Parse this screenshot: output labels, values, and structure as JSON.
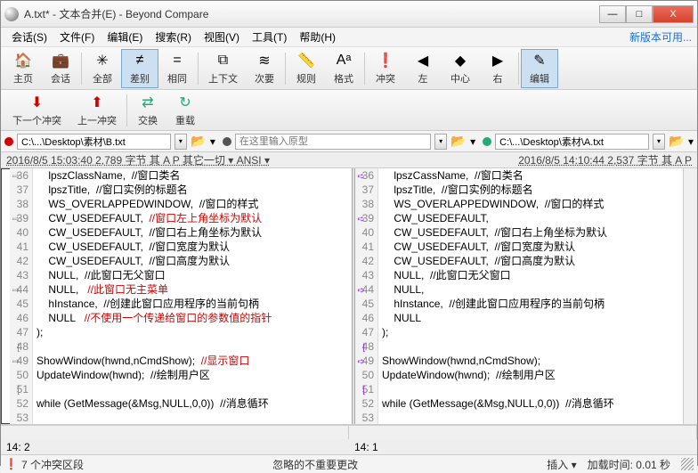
{
  "title": "A.txt* - 文本合并(E) - Beyond Compare",
  "window_buttons": {
    "min": "—",
    "max": "□",
    "close": "X"
  },
  "menu": [
    "会话(S)",
    "文件(F)",
    "编辑(E)",
    "搜索(R)",
    "视图(V)",
    "工具(T)",
    "帮助(H)"
  ],
  "menu_right": "新版本可用...",
  "toolbar1": [
    {
      "icon": "🏠",
      "label": "主页",
      "name": "home"
    },
    {
      "icon": "💼",
      "label": "会话",
      "name": "session"
    },
    {
      "sep": true
    },
    {
      "icon": "✳",
      "label": "全部",
      "name": "all"
    },
    {
      "icon": "≠",
      "label": "差别",
      "name": "diff",
      "pressed": true
    },
    {
      "icon": "=",
      "label": "相同",
      "name": "same"
    },
    {
      "sep": true
    },
    {
      "icon": "⧉",
      "label": "上下文",
      "name": "context"
    },
    {
      "icon": "≋",
      "label": "次要",
      "name": "minor"
    },
    {
      "sep": true
    },
    {
      "icon": "📏",
      "label": "规则",
      "name": "rules"
    },
    {
      "icon": "Aᵃ",
      "label": "格式",
      "name": "format"
    },
    {
      "sep": true
    },
    {
      "icon": "❗",
      "label": "冲突",
      "name": "conflict"
    },
    {
      "icon": "◀",
      "label": "左",
      "name": "left"
    },
    {
      "icon": "◆",
      "label": "中心",
      "name": "center"
    },
    {
      "icon": "▶",
      "label": "右",
      "name": "right"
    },
    {
      "sep": true
    },
    {
      "icon": "✎",
      "label": "编辑",
      "name": "edit",
      "pressed": true
    }
  ],
  "toolbar2": [
    {
      "icon": "⬇",
      "label": "下一个冲突",
      "name": "next-conflict",
      "color": "#d00000"
    },
    {
      "icon": "⬆",
      "label": "上一冲突",
      "name": "prev-conflict",
      "color": "#d00000"
    },
    {
      "sep": true
    },
    {
      "icon": "⇄",
      "label": "交换",
      "name": "swap",
      "color": "#2a7"
    },
    {
      "icon": "↻",
      "label": "重载",
      "name": "reload",
      "color": "#2a7"
    }
  ],
  "paths": {
    "left": {
      "dot": "#d00000",
      "value": "C:\\...\\Desktop\\素材\\B.txt"
    },
    "mid": {
      "dot": "#555",
      "placeholder": "在这里输入原型"
    },
    "right": {
      "dot": "#2a7",
      "value": "C:\\...\\Desktop\\素材\\A.txt"
    }
  },
  "info": {
    "left": "2016/8/5 15:03:40   2,789 字节   其   A   P   其它一切 ▾   ANSI ▾",
    "right": "2016/8/5 14:10:44   2,537 字节   其   A   P"
  },
  "left_lines": [
    {
      "n": 36,
      "a": "⇨",
      "t": "    lpszClassName,  //窗口类名"
    },
    {
      "n": 37,
      "t": "    lpszTitle,  //窗口实例的标题名"
    },
    {
      "n": 38,
      "t": "    WS_OVERLAPPEDWINDOW,  //窗口的样式"
    },
    {
      "n": 39,
      "a": "⇨",
      "t": "    CW_USEDEFAULT,  ",
      "r": "//窗口左上角坐标为默认"
    },
    {
      "n": 40,
      "t": "    CW_USEDEFAULT,  //窗口右上角坐标为默认"
    },
    {
      "n": 41,
      "t": "    CW_USEDEFAULT,  //窗口宽度为默认"
    },
    {
      "n": 42,
      "t": "    CW_USEDEFAULT,  //窗口高度为默认"
    },
    {
      "n": 43,
      "t": "    NULL,  //此窗口无父窗口"
    },
    {
      "n": 44,
      "a": "⇨",
      "t": "    NULL,   ",
      "r": "//此窗口无主菜单"
    },
    {
      "n": 45,
      "t": "    hInstance,  //创建此窗口应用程序的当前句柄"
    },
    {
      "n": 46,
      "t": "    NULL   ",
      "r": "//不使用一个传递给窗口的参数值的指针"
    },
    {
      "n": 47,
      "t": ");"
    },
    {
      "n": 48,
      "a": "[",
      "t": ""
    },
    {
      "n": 49,
      "a": "⇨",
      "t": "ShowWindow(hwnd,nCmdShow);  ",
      "r": "//显示窗口"
    },
    {
      "n": 50,
      "t": "UpdateWindow(hwnd);  //绘制用户区"
    },
    {
      "n": 51,
      "a": "[",
      "t": ""
    },
    {
      "n": 52,
      "t": "while (GetMessage(&Msg,NULL,0,0))  //消息循环"
    },
    {
      "n": 53,
      "t": ""
    }
  ],
  "right_lines": [
    {
      "n": 36,
      "a": "➪",
      "t": "    lpszCassName,  //窗口类名"
    },
    {
      "n": 37,
      "t": "    lpszTitle,  //窗口实例的标题名"
    },
    {
      "n": 38,
      "t": "    WS_OVERLAPPEDWINDOW,  //窗口的样式"
    },
    {
      "n": 39,
      "a": "➪",
      "t": "    CW_USEDEFAULT,"
    },
    {
      "n": 40,
      "t": "    CW_USEDEFAULT,  //窗口右上角坐标为默认"
    },
    {
      "n": 41,
      "t": "    CW_USEDEFAULT,  //窗口宽度为默认"
    },
    {
      "n": 42,
      "t": "    CW_USEDEFAULT,  //窗口高度为默认"
    },
    {
      "n": 43,
      "t": "    NULL,  //此窗口无父窗口"
    },
    {
      "n": 44,
      "a": "➪",
      "t": "    NULL,"
    },
    {
      "n": 45,
      "t": "    hInstance,  //创建此窗口应用程序的当前句柄"
    },
    {
      "n": 46,
      "t": "    NULL"
    },
    {
      "n": 47,
      "t": ");"
    },
    {
      "n": 48,
      "a": "[",
      "t": ""
    },
    {
      "n": 49,
      "a": "➪",
      "t": "ShowWindow(hwnd,nCmdShow);"
    },
    {
      "n": 50,
      "t": "UpdateWindow(hwnd);  //绘制用户区"
    },
    {
      "n": 51,
      "a": "[",
      "t": ""
    },
    {
      "n": 52,
      "t": "while (GetMessage(&Msg,NULL,0,0))  //消息循环"
    },
    {
      "n": 53,
      "t": ""
    }
  ],
  "pos": {
    "left": "14: 2",
    "right": "14: 1"
  },
  "status": {
    "conflicts": "7 个冲突区段",
    "ignored": "忽略的不重要更改",
    "insert": "插入 ▾",
    "loadtime": "加载时间: 0.01 秒"
  }
}
